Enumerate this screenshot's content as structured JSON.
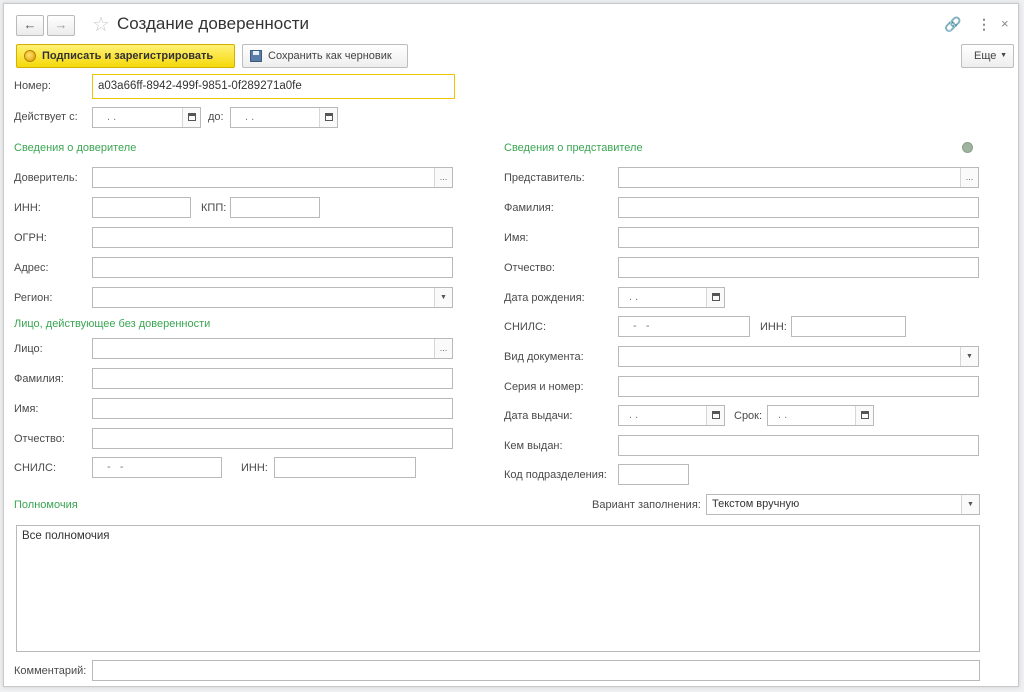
{
  "window": {
    "title": "Создание доверенности",
    "nav": {
      "back": "🡐",
      "forward": "🡒"
    },
    "icons": {
      "star": "star-icon",
      "link": "link-icon",
      "more": "more-vertical-icon",
      "close": "close-icon"
    }
  },
  "toolbar": {
    "sign_label": "Подписать и зарегистрировать",
    "save_draft_label": "Сохранить как черновик",
    "more_label": "Еще"
  },
  "header": {
    "number_label": "Номер:",
    "number_value": "a03a66ff-8942-499f-9851-0f289271a0fe",
    "valid_from_label": "Действует с:",
    "valid_from_value": ". .",
    "valid_to_label": "до:",
    "valid_to_value": ". ."
  },
  "principal": {
    "section_title": "Сведения о доверителе",
    "principal_label": "Доверитель:",
    "inn_label": "ИНН:",
    "kpp_label": "КПП:",
    "ogrn_label": "ОГРН:",
    "address_label": "Адрес:",
    "region_label": "Регион:"
  },
  "person": {
    "section_title": "Лицо, действующее без доверенности",
    "person_label": "Лицо:",
    "surname_label": "Фамилия:",
    "name_label": "Имя:",
    "patronymic_label": "Отчество:",
    "snils_label": "СНИЛС:",
    "snils_value": "-   -",
    "inn_label": "ИНН:"
  },
  "representative": {
    "section_title": "Сведения о представителе",
    "representative_label": "Представитель:",
    "surname_label": "Фамилия:",
    "name_label": "Имя:",
    "patronymic_label": "Отчество:",
    "birthdate_label": "Дата рождения:",
    "birthdate_value": ". .",
    "snils_label": "СНИЛС:",
    "snils_value": "-   -",
    "inn_label": "ИНН:",
    "doc_type_label": "Вид документа:",
    "series_label": "Серия и номер:",
    "issue_date_label": "Дата выдачи:",
    "issue_date_value": ". .",
    "term_label": "Срок:",
    "term_value": ". .",
    "issued_by_label": "Кем выдан:",
    "dept_code_label": "Код подразделения:"
  },
  "powers": {
    "section_title": "Полномочия",
    "fill_variant_label": "Вариант заполнения:",
    "fill_variant_value": "Текстом вручную",
    "text": "Все полномочия"
  },
  "footer": {
    "comment_label": "Комментарий:"
  },
  "colors": {
    "section": "#3aa553",
    "primary_button": "#f5d90a",
    "active_field_border": "#f0c400"
  }
}
